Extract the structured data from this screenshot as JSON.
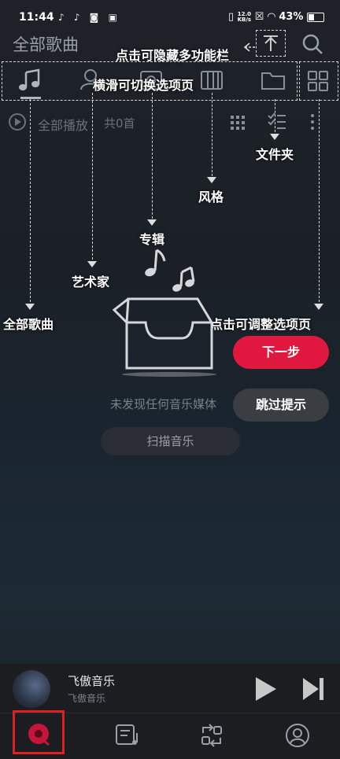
{
  "status": {
    "time": "11:44",
    "speed_top": "12.0",
    "speed_unit": "KB/s",
    "battery": "43%"
  },
  "header": {
    "title": "全部歌曲"
  },
  "subbar": {
    "play_all": "全部播放",
    "count": "共0首"
  },
  "hints": {
    "hide_bar": "点击可隐藏多功能栏",
    "swipe": "横滑可切换选项页",
    "folder": "文件夹",
    "style": "风格",
    "album": "专辑",
    "artist": "艺术家",
    "all_songs": "全部歌曲",
    "adjust_tabs": "点击可调整选项页"
  },
  "empty": {
    "message": "未发现任何音乐媒体",
    "scan": "扫描音乐"
  },
  "buttons": {
    "next": "下一步",
    "skip": "跳过提示"
  },
  "player": {
    "title": "飞傲音乐",
    "subtitle": "飞傲音乐"
  },
  "colors": {
    "accent": "#e0173f",
    "highlight_box": "#e02020"
  }
}
